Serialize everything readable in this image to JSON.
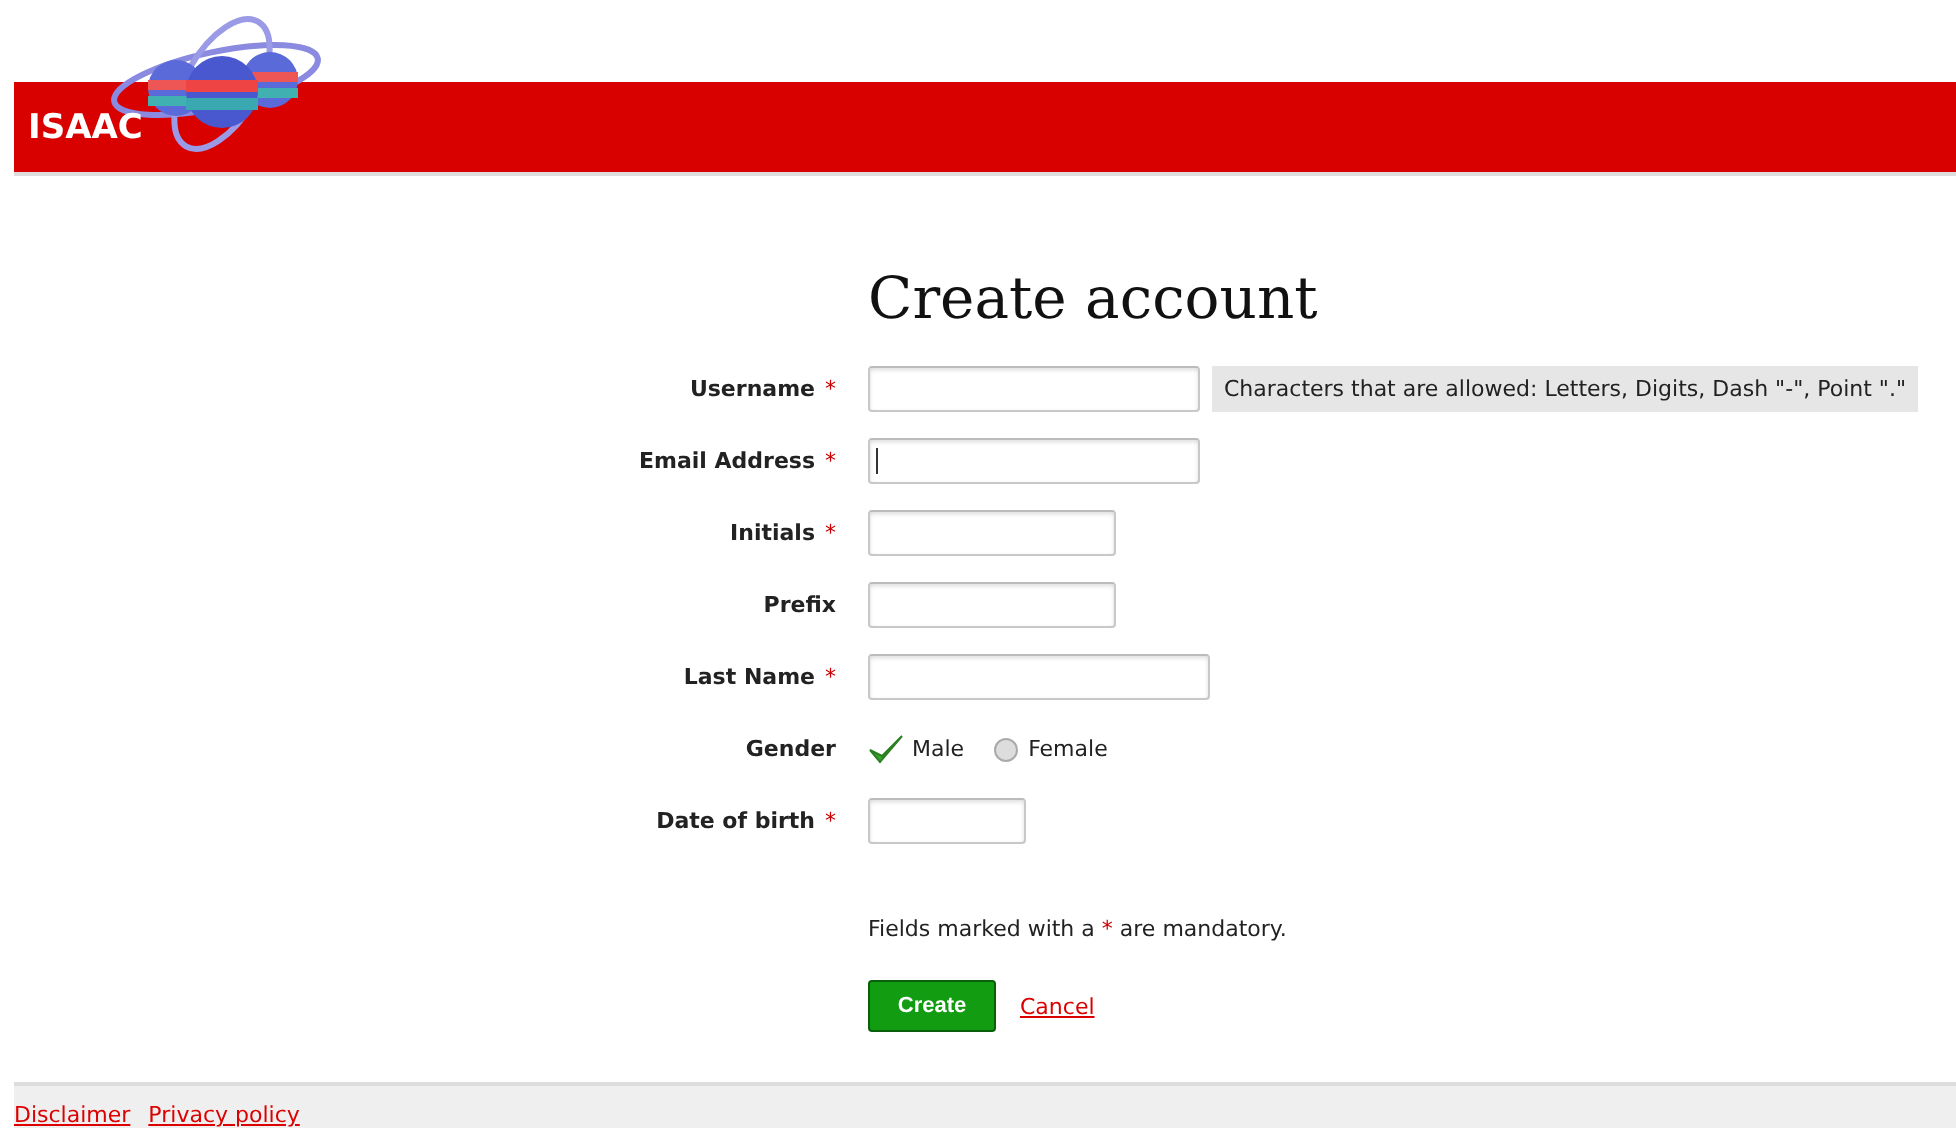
{
  "header": {
    "site_name": "ISAAC"
  },
  "title": "Create account",
  "fields": [
    {
      "kind": "text",
      "label": "Username",
      "required_mark": "*",
      "hint": "Characters that are allowed: Letters, Digits, Dash \"-\", Point \".\""
    },
    {
      "kind": "text",
      "label": "Email Address",
      "required_mark": "*",
      "focused": true
    },
    {
      "kind": "text",
      "label": "Initials",
      "required_mark": "*"
    },
    {
      "kind": "text",
      "label": "Prefix"
    },
    {
      "kind": "text",
      "label": "Last Name",
      "required_mark": "*"
    },
    {
      "kind": "radio",
      "label": "Gender",
      "options": [
        {
          "label": "Male",
          "selected": true
        },
        {
          "label": "Female",
          "selected": false
        }
      ]
    },
    {
      "kind": "text",
      "label": "Date of birth",
      "required_mark": "*"
    }
  ],
  "note": {
    "before": "Fields marked with a",
    "mark": "*",
    "after": "are mandatory."
  },
  "buttons": [
    {
      "kind": "primary",
      "label": "Create"
    },
    {
      "kind": "link",
      "label": "Cancel"
    }
  ],
  "footer": {
    "links": [
      "Disclaimer",
      "Privacy policy"
    ]
  }
}
